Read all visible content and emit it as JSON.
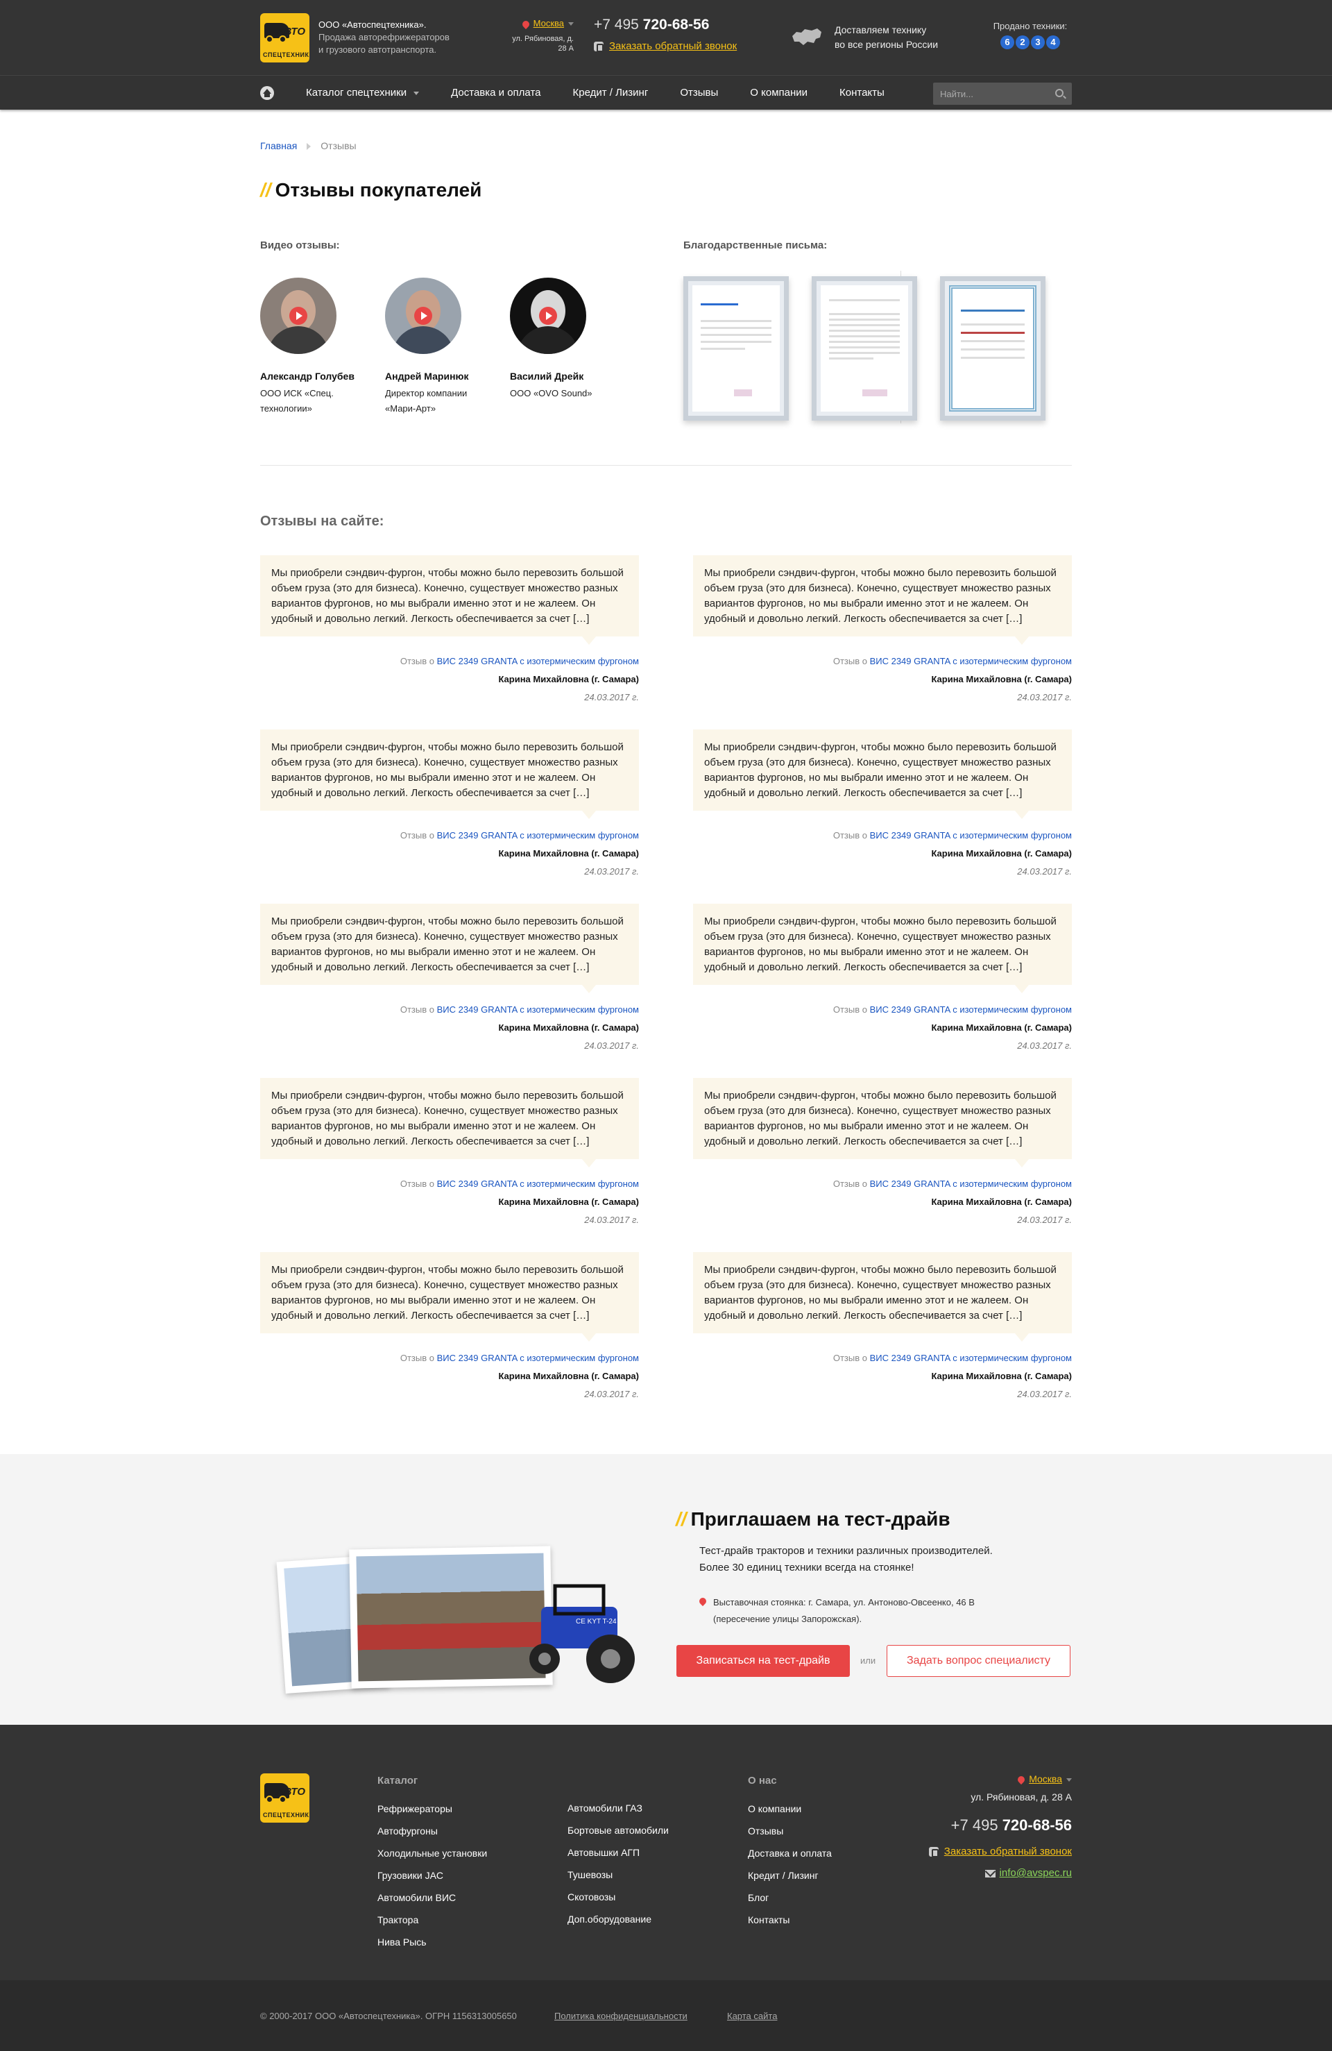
{
  "header": {
    "logo_text_top": "АВТО",
    "logo_text_bottom": "СПЕЦТЕХНИКА",
    "company_name": "ООО «Автоспецтехника».",
    "company_desc_1": "Продажа авторефрижераторов",
    "company_desc_2": "и грузового автотранспорта.",
    "city": "Москва",
    "address_1": "ул. Рябиновая,",
    "address_2": "д. 28 А",
    "phone_code": "+7 495",
    "phone_number": "720-68-56",
    "callback_label": "Заказать обратный звонок",
    "delivery_1": "Доставляем технику",
    "delivery_2": "во все регионы России",
    "sold_label": "Продано техники:",
    "sold_digits": [
      "6",
      "2",
      "3",
      "4"
    ]
  },
  "nav": {
    "items": [
      "Каталог спецтехники",
      "Доставка и оплата",
      "Кредит / Лизинг",
      "Отзывы",
      "О компании",
      "Контакты"
    ],
    "search_placeholder": "Найти..."
  },
  "breadcrumb": {
    "home": "Главная",
    "current": "Отзывы"
  },
  "page_title": "Отзывы покупателей",
  "video_section": {
    "title": "Видео отзывы:",
    "items": [
      {
        "name": "Александр Голубев",
        "position_1": "ООО ИСК «Спец.",
        "position_2": "технологии»"
      },
      {
        "name": "Андрей Маринюк",
        "position_1": "Директор компании",
        "position_2": "«Мари-Арт»"
      },
      {
        "name": "Василий Дрейк",
        "position_1": "ООО «OVO Sound»",
        "position_2": ""
      }
    ]
  },
  "letters_section": {
    "title": "Благодарственные письма:"
  },
  "reviews_section": {
    "title": "Отзывы на сайте:",
    "review": {
      "text": "Мы приобрели сэндвич-фургон, чтобы можно было перевозить большой объем груза (это для бизнеса). Конечно, существует множество разных вариантов фургонов, но мы выбрали именно этот и не жалеем. Он удобный и довольно легкий. Легкость обеспечивается за счет […]",
      "about_prefix": "Отзыв о",
      "product": "ВИС 2349 GRANTA с изотермическим фургоном",
      "author": "Карина Михайловна (г. Самара)",
      "date": "24.03.2017 г."
    }
  },
  "testdrive": {
    "title": "Приглашаем на тест-драйв",
    "text_1": "Тест-драйв тракторов и техники различных производителей.",
    "text_2": "Более 30 единиц техники всегда на стоянке!",
    "address_1": "Выставочная стоянка: г. Самара, ул. Антоново-Овсеенко, 46 В",
    "address_2": "(пересечение улицы Запорожская).",
    "btn_primary": "Записаться на тест-драйв",
    "or": "или",
    "btn_secondary": "Задать вопрос специалисту",
    "tractor_label": "CE KYT T-24"
  },
  "footer": {
    "catalog_title": "Каталог",
    "catalog_col1": [
      "Рефрижераторы",
      "Автофургоны",
      "Холодильные установки",
      "Грузовики JAC",
      "Автомобили ВИС",
      "Трактора",
      "Нива Рысь"
    ],
    "catalog_col2": [
      "Автомобили ГАЗ",
      "Бортовые автомобили",
      "Автовышки АГП",
      "Тушевозы",
      "Скотовозы",
      "Доп.оборудование"
    ],
    "about_title": "О нас",
    "about_items": [
      "О компании",
      "Отзывы",
      "Доставка и оплата",
      "Кредит / Лизинг",
      "Блог",
      "Контакты"
    ],
    "city": "Москва",
    "address": "ул. Рябиновая, д. 28 А",
    "phone_code": "+7 495",
    "phone_number": "720-68-56",
    "callback_label": "Заказать обратный звонок",
    "email": "info@avspec.ru",
    "copyright": "© 2000-2017 ООО «Автоспецтехника». ОГРН 1156313005650",
    "privacy": "Политика конфиденциальности",
    "sitemap": "Карта сайта"
  },
  "colors": {
    "accent": "#f6c117",
    "red": "#e84545",
    "dark": "#343434",
    "link": "#1a55c0",
    "review_bg": "#fbf6e9"
  }
}
